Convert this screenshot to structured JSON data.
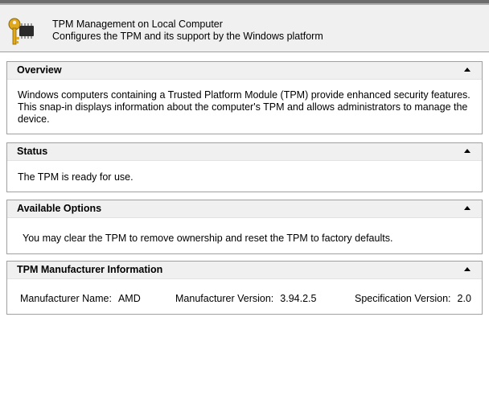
{
  "header": {
    "title": "TPM Management on Local Computer",
    "subtitle": "Configures the TPM and its support by the Windows platform",
    "icon": "key-chip-icon"
  },
  "overview": {
    "title": "Overview",
    "text": "Windows computers containing a Trusted Platform Module (TPM) provide enhanced security features. This snap-in displays information about the computer's TPM and allows administrators to manage the device."
  },
  "status": {
    "title": "Status",
    "text": "The TPM is ready for use."
  },
  "options": {
    "title": "Available Options",
    "text": "You may clear the TPM to remove ownership and reset the TPM to factory defaults."
  },
  "manufacturer": {
    "title": "TPM Manufacturer Information",
    "name_label": "Manufacturer Name:",
    "name_value": "AMD",
    "version_label": "Manufacturer Version:",
    "version_value": "3.94.2.5",
    "spec_label": "Specification Version:",
    "spec_value": "2.0"
  },
  "colors": {
    "header_bg": "#f0f0f0",
    "border": "#a0a0a0",
    "key_gold": "#e0a81c"
  }
}
